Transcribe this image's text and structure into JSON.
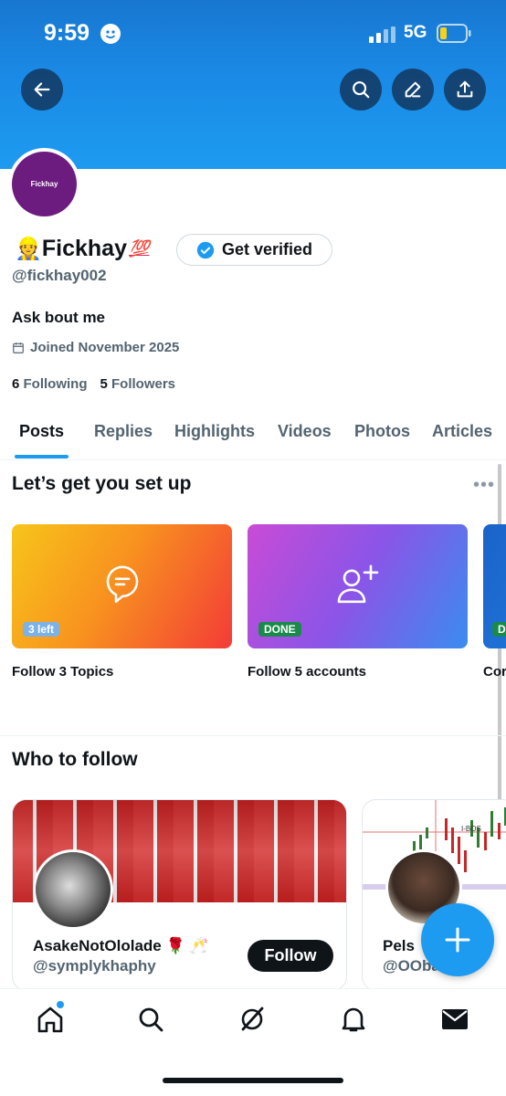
{
  "status_bar": {
    "time": "9:59",
    "network": "5G"
  },
  "profile": {
    "avatar_text": "Fickhay",
    "name_emoji": "👷",
    "name": "Fickhay",
    "name_suffix": "💯",
    "verify_label": "Get verified",
    "handle": "@fickhay002",
    "bio": "Ask bout me",
    "joined": "Joined November 2025",
    "following_count": "6",
    "following_label": "Following",
    "followers_count": "5",
    "followers_label": "Followers"
  },
  "tabs": [
    "Posts",
    "Replies",
    "Highlights",
    "Videos",
    "Photos",
    "Articles"
  ],
  "setup": {
    "title": "Let’s get you set up",
    "cards": [
      {
        "pill": "3 left",
        "caption": "Follow 3 Topics"
      },
      {
        "pill": "DONE",
        "caption": "Follow 5 accounts"
      },
      {
        "pill": "D",
        "caption": "Cor"
      }
    ]
  },
  "who_to_follow": {
    "title": "Who to follow",
    "accounts": [
      {
        "name": "AsakeNotOlolade 🌹 🥂",
        "handle": "@symplykhaphy",
        "button": "Follow"
      },
      {
        "name": "Pels",
        "handle": "@OOba"
      }
    ]
  },
  "icons": {
    "back": "arrow-left-icon",
    "search": "search-icon",
    "edit": "pencil-icon",
    "share": "share-upload-icon",
    "compose": "plus-icon",
    "home": "home-icon",
    "explore": "search-icon",
    "grok": "grok-icon",
    "notifications": "bell-icon",
    "messages": "mail-icon"
  },
  "colors": {
    "accent": "#1d9bf0",
    "header_top": "#1877d0",
    "text": "#0f1419",
    "muted": "#536471"
  }
}
